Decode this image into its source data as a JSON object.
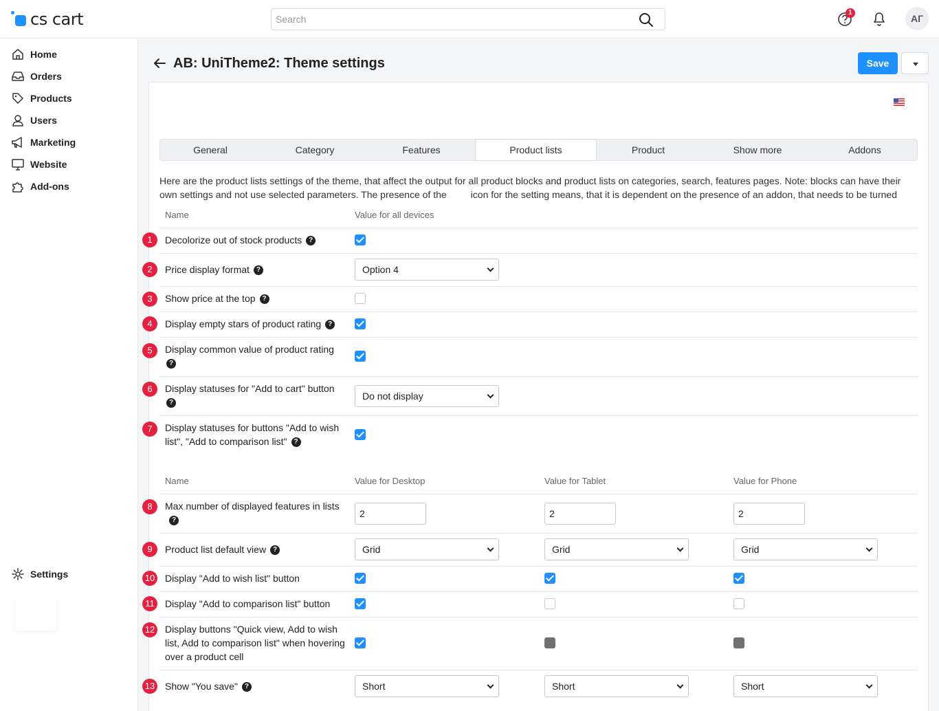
{
  "header": {
    "logo_text": "cs cart",
    "search_placeholder": "Search",
    "help_badge": "1",
    "avatar_initials": "АГ"
  },
  "sidebar": {
    "items": [
      {
        "label": "Home",
        "icon": "home-icon"
      },
      {
        "label": "Orders",
        "icon": "inbox-icon"
      },
      {
        "label": "Products",
        "icon": "tag-icon"
      },
      {
        "label": "Users",
        "icon": "user-icon"
      },
      {
        "label": "Marketing",
        "icon": "megaphone-icon"
      },
      {
        "label": "Website",
        "icon": "monitor-icon"
      },
      {
        "label": "Add-ons",
        "icon": "puzzle-icon"
      }
    ],
    "settings_label": "Settings"
  },
  "page": {
    "title": "AB: UniTheme2: Theme settings",
    "save_label": "Save"
  },
  "tabs": [
    "General",
    "Category",
    "Features",
    "Product lists",
    "Product",
    "Show more",
    "Addons"
  ],
  "active_tab": "Product lists",
  "description": "Here are the product lists settings of the theme, that affect the output for all product blocks and product lists on categories, search, features pages. Note: blocks can have their own settings and not use selected parameters. The presence of the         icon for the setting means, that it is dependent on the presence of an addon, that needs to be turned on",
  "table1": {
    "headers": [
      "Name",
      "Value for all devices"
    ],
    "rows": [
      {
        "num": "1",
        "label": "Decolorize out of stock products",
        "control": "checkbox",
        "value": true
      },
      {
        "num": "2",
        "label": "Price display format",
        "control": "select",
        "value": "Option 4"
      },
      {
        "num": "3",
        "label": "Show price at the top",
        "control": "checkbox",
        "value": false
      },
      {
        "num": "4",
        "label": "Display empty stars of product rating",
        "control": "checkbox",
        "value": true
      },
      {
        "num": "5",
        "label": "Display common value of product rating",
        "control": "checkbox",
        "value": true
      },
      {
        "num": "6",
        "label": "Display statuses for \"Add to cart\" button",
        "control": "select",
        "value": "Do not display"
      },
      {
        "num": "7",
        "label": "Display statuses for buttons \"Add to wish list\", \"Add to comparison list\"",
        "control": "checkbox",
        "value": true
      }
    ]
  },
  "table2": {
    "headers": [
      "Name",
      "Value for Desktop",
      "Value for Tablet",
      "Value for Phone"
    ],
    "rows": [
      {
        "num": "8",
        "label": "Max number of displayed features in lists",
        "control": "input",
        "values": [
          "2",
          "2",
          "2"
        ]
      },
      {
        "num": "9",
        "label": "Product list default view",
        "control": "select",
        "values": [
          "Grid",
          "Grid",
          "Grid"
        ]
      },
      {
        "num": "10",
        "label": "Display \"Add to wish list\" button",
        "control": "checkbox",
        "values": [
          "on",
          "on",
          "on"
        ]
      },
      {
        "num": "11",
        "label": "Display \"Add to comparison list\" button",
        "control": "checkbox",
        "values": [
          "on",
          "off",
          "off"
        ]
      },
      {
        "num": "12",
        "label": "Display buttons \"Quick view, Add to wish list, Add to comparison list\" when hovering over a product cell",
        "control": "checkbox",
        "values": [
          "on",
          "disabled",
          "disabled"
        ]
      },
      {
        "num": "13",
        "label": "Show \"You save\"",
        "control": "select",
        "values": [
          "Short",
          "Short",
          "Short"
        ]
      }
    ]
  },
  "colors": {
    "accent": "#1e90ff",
    "number_badge": "#e5213f",
    "background": "#f4f5f7"
  }
}
